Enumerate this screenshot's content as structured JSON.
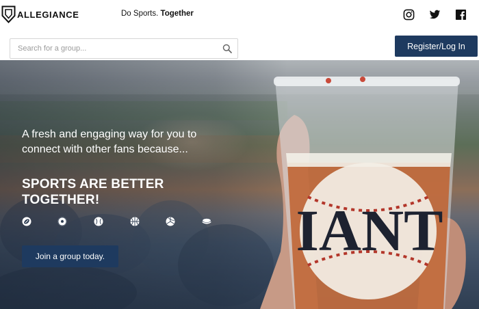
{
  "brand": {
    "name": "ALLEGIANCE"
  },
  "header": {
    "tagline_regular": "Do Sports. ",
    "tagline_bold": "Together",
    "social": [
      {
        "icon": "instagram-icon"
      },
      {
        "icon": "twitter-icon"
      },
      {
        "icon": "facebook-icon"
      }
    ]
  },
  "search": {
    "placeholder": "Search for a group...",
    "value": "",
    "icon": "search-icon"
  },
  "auth": {
    "register_label": "Register/Log In"
  },
  "hero": {
    "lead": "A fresh and engaging way for you to connect with other fans because...",
    "title": "SPORTS ARE BETTER TOGETHER!",
    "sports_icons": [
      "football-icon",
      "soccer-ball-icon",
      "baseball-icon",
      "basketball-icon",
      "volleyball-icon",
      "hockey-puck-icon"
    ],
    "cup_text": "IANT",
    "cta_label": "Join a group today."
  },
  "colors": {
    "accent": "#1e3a5f",
    "text_dark": "#111111",
    "hero_text": "#ffffff"
  }
}
